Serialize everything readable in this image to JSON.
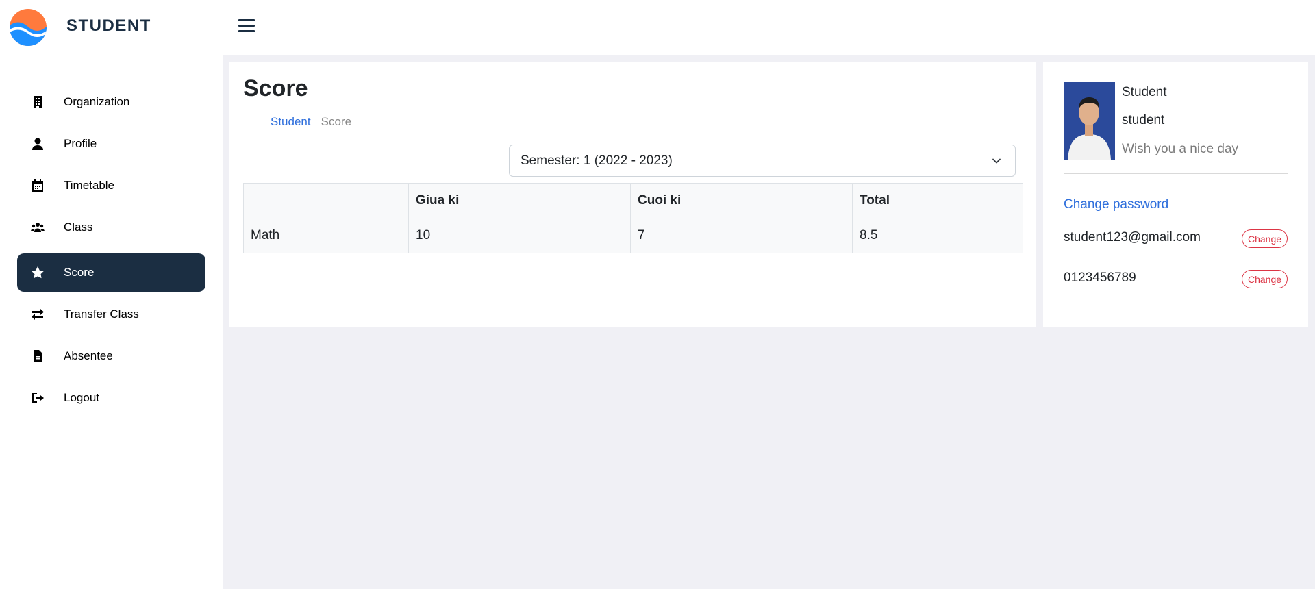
{
  "app": {
    "brand": "STUDENT"
  },
  "sidebar": {
    "items": [
      {
        "label": "Organization",
        "icon": "building-icon",
        "active": false
      },
      {
        "label": "Profile",
        "icon": "user-icon",
        "active": false
      },
      {
        "label": "Timetable",
        "icon": "calendar-icon",
        "active": false
      },
      {
        "label": "Class",
        "icon": "users-icon",
        "active": false
      },
      {
        "label": "Score",
        "icon": "star-icon",
        "active": true
      },
      {
        "label": "Transfer Class",
        "icon": "transfer-icon",
        "active": false
      },
      {
        "label": "Absentee",
        "icon": "file-icon",
        "active": false
      },
      {
        "label": "Logout",
        "icon": "logout-icon",
        "active": false
      }
    ]
  },
  "main": {
    "title": "Score",
    "breadcrumb": {
      "parent": "Student",
      "current": "Score"
    },
    "semester_select": {
      "value": "Semester: 1 (2022 - 2023)"
    },
    "table": {
      "headers": [
        "",
        "Giua ki",
        "Cuoi ki",
        "Total"
      ],
      "rows": [
        [
          "Math",
          "10",
          "7",
          "8.5"
        ]
      ]
    }
  },
  "profile": {
    "name": "Student",
    "role": "student",
    "greeting": "Wish you a nice day",
    "change_password_label": "Change password",
    "email": "student123@gmail.com",
    "phone": "0123456789",
    "change_label": "Change"
  },
  "colors": {
    "primary_dark": "#1b2e42",
    "link": "#2f6fdc",
    "danger": "#dc3545",
    "background": "#f0f0f5"
  }
}
